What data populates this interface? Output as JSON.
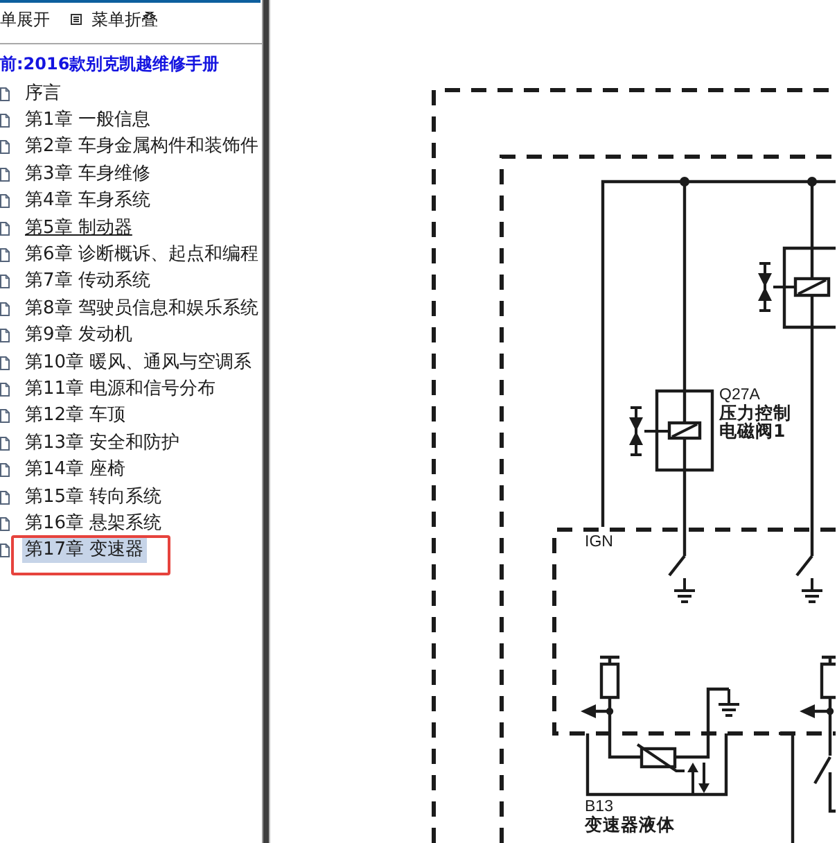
{
  "toolbar": {
    "expand_label": "单展开",
    "collapse_label": "菜单折叠"
  },
  "tree": {
    "title": "前:2016款别克凯越维修手册",
    "items": [
      {
        "label": "序言",
        "selected": false,
        "hovered": false,
        "outlined": false
      },
      {
        "label": "第1章 一般信息",
        "selected": false,
        "hovered": false,
        "outlined": false
      },
      {
        "label": "第2章 车身金属构件和装饰件",
        "selected": false,
        "hovered": false,
        "outlined": false
      },
      {
        "label": "第3章 车身维修",
        "selected": false,
        "hovered": false,
        "outlined": false
      },
      {
        "label": "第4章 车身系统",
        "selected": false,
        "hovered": false,
        "outlined": false
      },
      {
        "label": "第5章 制动器",
        "selected": false,
        "hovered": true,
        "outlined": false
      },
      {
        "label": "第6章 诊断概诉、起点和编程",
        "selected": false,
        "hovered": false,
        "outlined": false
      },
      {
        "label": "第7章 传动系统",
        "selected": false,
        "hovered": false,
        "outlined": false
      },
      {
        "label": "第8章 驾驶员信息和娱乐系统",
        "selected": false,
        "hovered": false,
        "outlined": false
      },
      {
        "label": "第9章 发动机",
        "selected": false,
        "hovered": false,
        "outlined": false
      },
      {
        "label": "第10章 暖风、通风与空调系",
        "selected": false,
        "hovered": false,
        "outlined": false
      },
      {
        "label": "第11章 电源和信号分布",
        "selected": false,
        "hovered": false,
        "outlined": false
      },
      {
        "label": "第12章 车顶",
        "selected": false,
        "hovered": false,
        "outlined": false
      },
      {
        "label": "第13章 安全和防护",
        "selected": false,
        "hovered": false,
        "outlined": false
      },
      {
        "label": "第14章 座椅",
        "selected": false,
        "hovered": false,
        "outlined": false
      },
      {
        "label": "第15章 转向系统",
        "selected": false,
        "hovered": false,
        "outlined": false
      },
      {
        "label": "第16章 悬架系统",
        "selected": false,
        "hovered": false,
        "outlined": false
      },
      {
        "label": "第17章 变速器",
        "selected": true,
        "hovered": false,
        "outlined": true
      }
    ]
  },
  "diagram": {
    "components": [
      {
        "ref": "Q27A",
        "name": [
          "压力控制",
          "电磁阀1"
        ]
      },
      {
        "ref": "B13",
        "name": [
          "变速器液体"
        ]
      }
    ],
    "wire_labels": [
      "IGN"
    ]
  }
}
